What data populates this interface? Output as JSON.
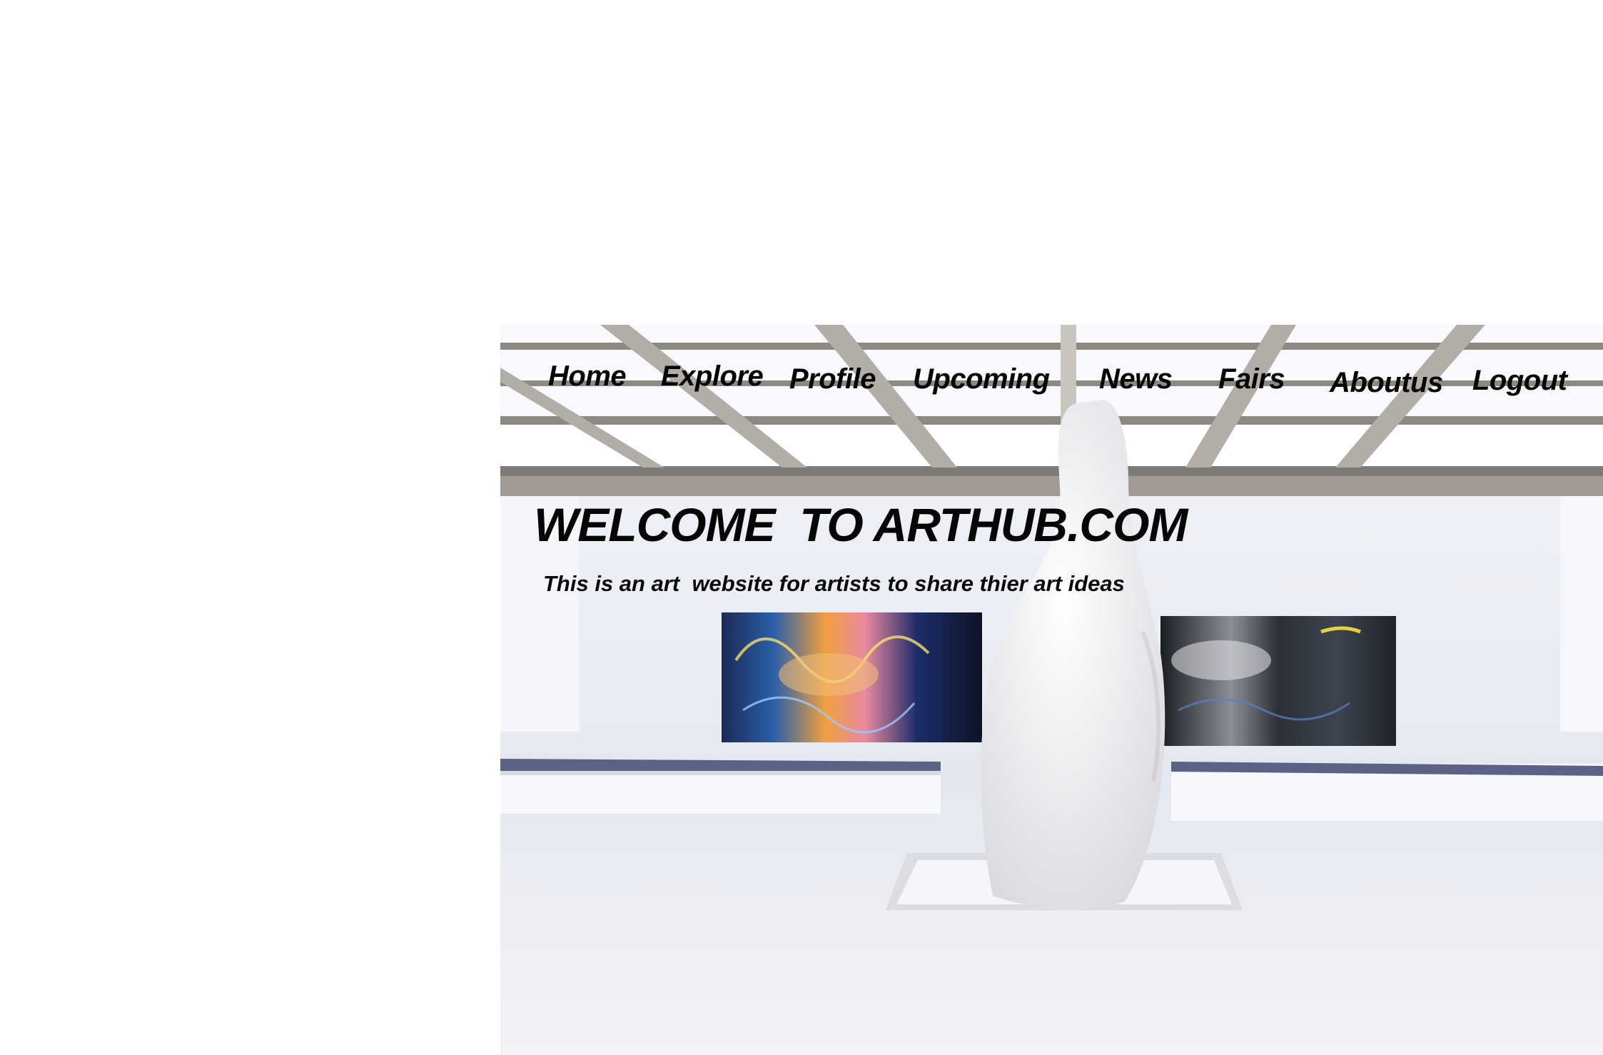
{
  "nav": {
    "items": [
      {
        "label": "Home"
      },
      {
        "label": "Explore"
      },
      {
        "label": "Profile"
      },
      {
        "label": "Upcoming"
      },
      {
        "label": "News"
      },
      {
        "label": "Fairs"
      },
      {
        "label": "Aboutus"
      },
      {
        "label": "Logout"
      }
    ]
  },
  "hero": {
    "title": "WELCOME  TO ARTHUB.COM",
    "subtitle": "This is an art  website for artists to share thier art ideas"
  },
  "colors": {
    "text": "#050505",
    "gallery_wall": "#f3f4f8",
    "ceiling_beam": "#9a948e",
    "bench_top": "#5a6288"
  }
}
